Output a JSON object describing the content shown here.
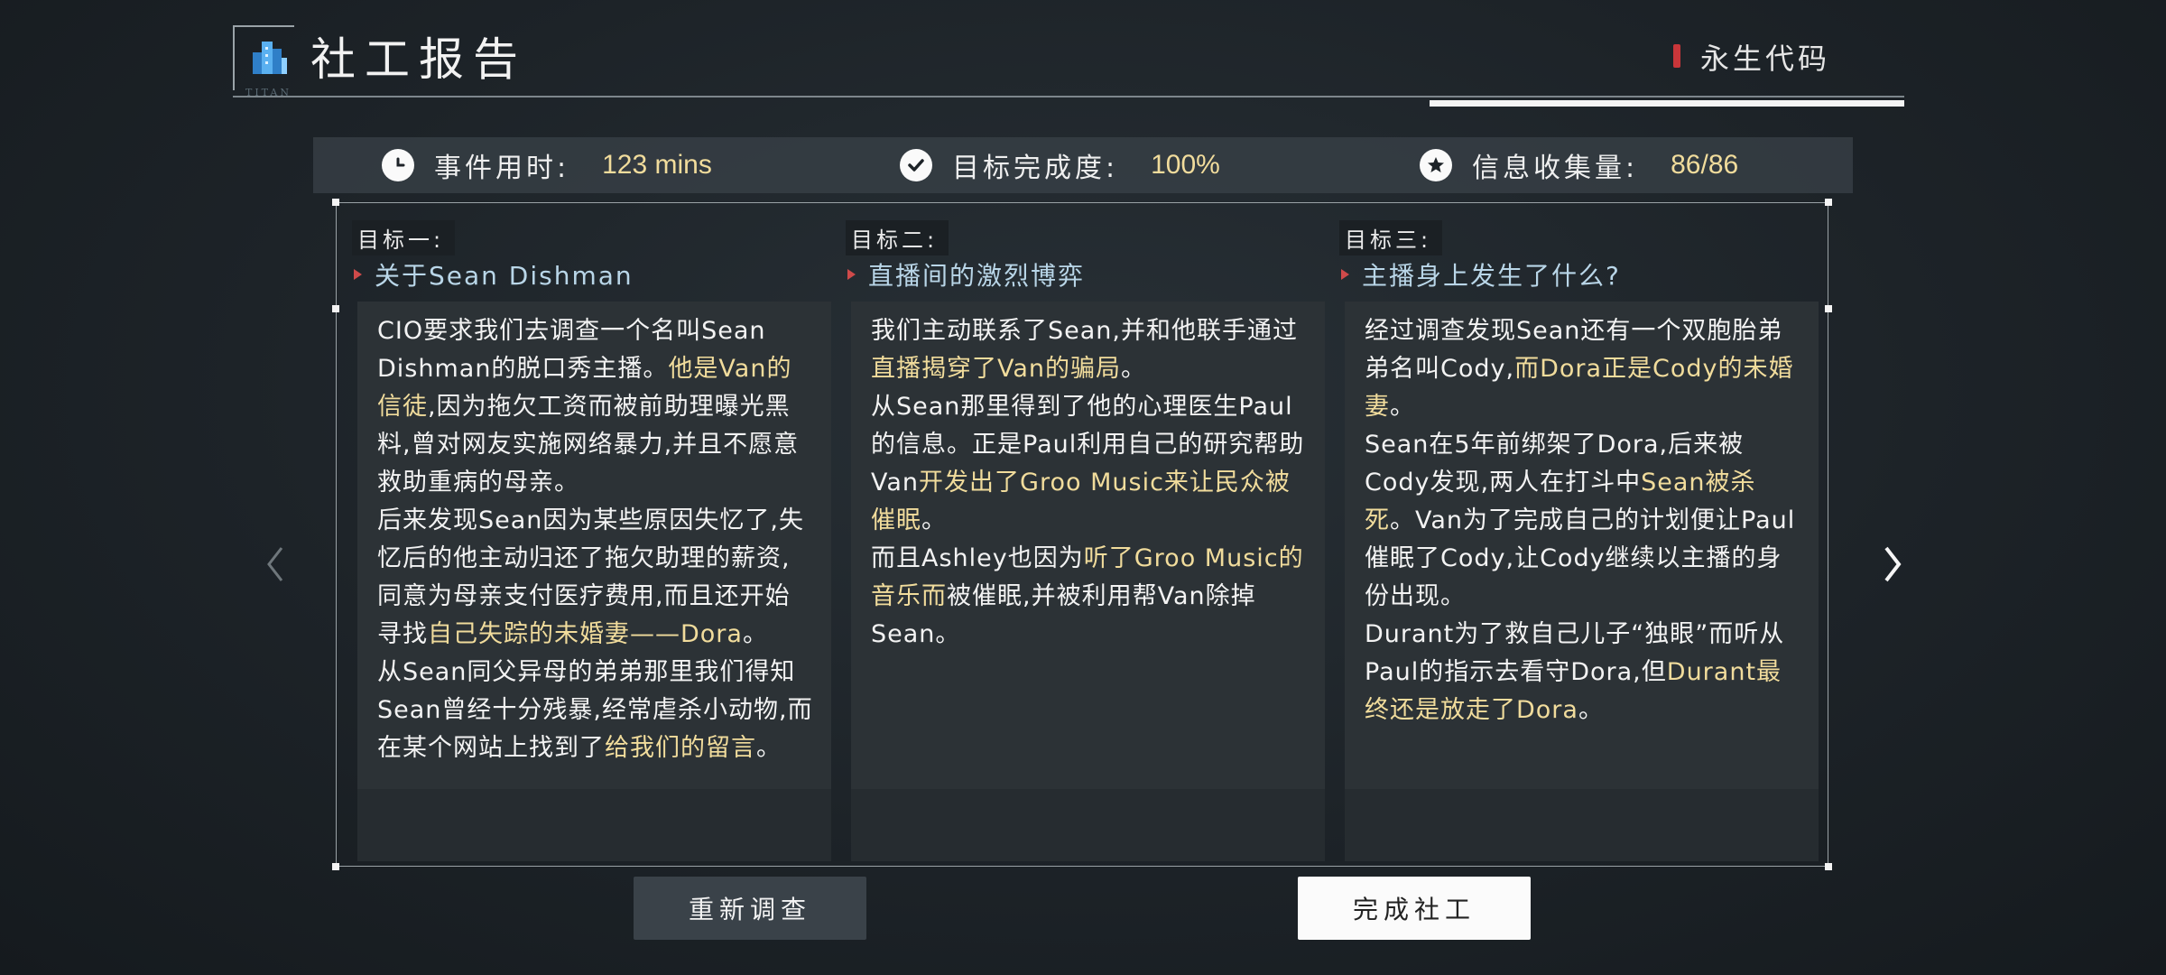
{
  "header": {
    "title": "社工报告",
    "logo_text": "TITAN",
    "code_label": "永生代码"
  },
  "stats": [
    {
      "label": "事件用时:",
      "value": "123 mins",
      "icon": "clock-icon"
    },
    {
      "label": "目标完成度:",
      "value": "100%",
      "icon": "check-icon"
    },
    {
      "label": "信息收集量:",
      "value": "86/86",
      "icon": "star-icon"
    }
  ],
  "goals": [
    {
      "tag": "目标一:",
      "title": "关于Sean Dishman",
      "paragraphs": [
        [
          {
            "t": "CIO要求我们去调查一个名叫Sean Dishman的脱口秀主播。",
            "h": false
          },
          {
            "t": "他是Van的信徒",
            "h": true
          },
          {
            "t": ",因为拖欠工资而被前助理曝光黑料,曾对网友实施网络暴力,并且不愿意救助重病的母亲。",
            "h": false
          }
        ],
        [
          {
            "t": "后来发现Sean因为某些原因失忆了,失忆后的他主动归还了拖欠助理的薪资,同意为母亲支付医疗费用,而且还开始寻找",
            "h": false
          },
          {
            "t": "自己失踪的未婚妻——Dora",
            "h": true
          },
          {
            "t": "。",
            "h": false
          }
        ],
        [
          {
            "t": "从Sean同父异母的弟弟那里我们得知Sean曾经十分残暴,经常虐杀小动物,而在某个网站上找到了",
            "h": false
          },
          {
            "t": "给我们的留言",
            "h": true
          },
          {
            "t": "。",
            "h": false
          }
        ]
      ]
    },
    {
      "tag": "目标二:",
      "title": "直播间的激烈博弈",
      "paragraphs": [
        [
          {
            "t": "我们主动联系了Sean,并和他联手通过",
            "h": false
          },
          {
            "t": "直播揭穿了Van的骗局",
            "h": true
          },
          {
            "t": "。",
            "h": false
          }
        ],
        [
          {
            "t": "从Sean那里得到了他的心理医生Paul的信息。正是Paul利用自己的研究帮助Van",
            "h": false
          },
          {
            "t": "开发出了Groo Music来让民众被催眠",
            "h": true
          },
          {
            "t": "。",
            "h": false
          }
        ],
        [
          {
            "t": "而且Ashley也因为",
            "h": false
          },
          {
            "t": "听了Groo Music的音乐而",
            "h": true
          },
          {
            "t": "被催眠,并被利用帮Van除掉Sean。",
            "h": false
          }
        ]
      ]
    },
    {
      "tag": "目标三:",
      "title": "主播身上发生了什么?",
      "paragraphs": [
        [
          {
            "t": "经过调查发现Sean还有一个双胞胎弟弟名叫Cody,",
            "h": false
          },
          {
            "t": "而Dora正是Cody的未婚妻",
            "h": true
          },
          {
            "t": "。",
            "h": false
          }
        ],
        [
          {
            "t": "Sean在5年前绑架了Dora,后来被Cody发现,两人在打斗中",
            "h": false
          },
          {
            "t": "Sean被杀死",
            "h": true
          },
          {
            "t": "。Van为了完成自己的计划便让Paul催眠了Cody,让Cody继续以主播的身份出现。",
            "h": false
          }
        ],
        [
          {
            "t": "Durant为了救自己儿子“独眼”而听从Paul的指示去看守Dora,但",
            "h": false
          },
          {
            "t": "Durant最终还是放走了Dora",
            "h": true
          },
          {
            "t": "。",
            "h": false
          }
        ]
      ]
    }
  ],
  "buttons": {
    "reinvestigate": "重新调查",
    "complete": "完成社工"
  },
  "colors": {
    "highlight": "#f1dc9c",
    "accent_red": "#c9363a",
    "title_blue": "#b9d6e8"
  }
}
